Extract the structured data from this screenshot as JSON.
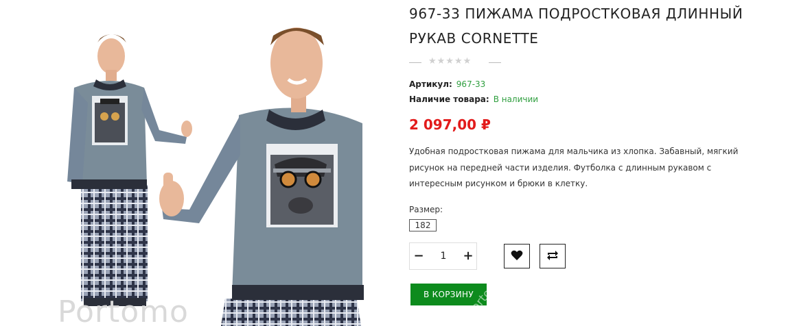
{
  "product": {
    "title": "967-33 ПИЖАМА ПОДРОСТКОВАЯ ДЛИННЫЙ РУКАВ CORNETTE",
    "rating_stars": "★★★★★",
    "sku_label": "Артикул:",
    "sku_value": "967-33",
    "availability_label": "Наличие товара:",
    "availability_value": "В наличии",
    "price": "2 097,00 ₽",
    "description": "Удобная подростковая пижама для мальчика из хлопка. Забавный, мягкий рисунок на передней части изделия. Футболка с длинным рукавом с интересным рисунком и брюки в клетку.",
    "size_label": "Размер:",
    "size_options": [
      "182"
    ],
    "selected_size": "182",
    "quantity": "1",
    "add_to_cart_label": "В КОРЗИНУ",
    "watermark": "Portomo",
    "watermark_cart": "portomo"
  },
  "colors": {
    "price": "#e21b1b",
    "in_stock": "#2e9e3e",
    "cart_button": "#0d8b1d",
    "sweater": "#7a8c99",
    "cuffs": "#2b2f3a"
  },
  "icons": {
    "wishlist": "heart-icon",
    "compare": "compare-arrows-icon",
    "minus": "minus-icon",
    "plus": "plus-icon"
  }
}
